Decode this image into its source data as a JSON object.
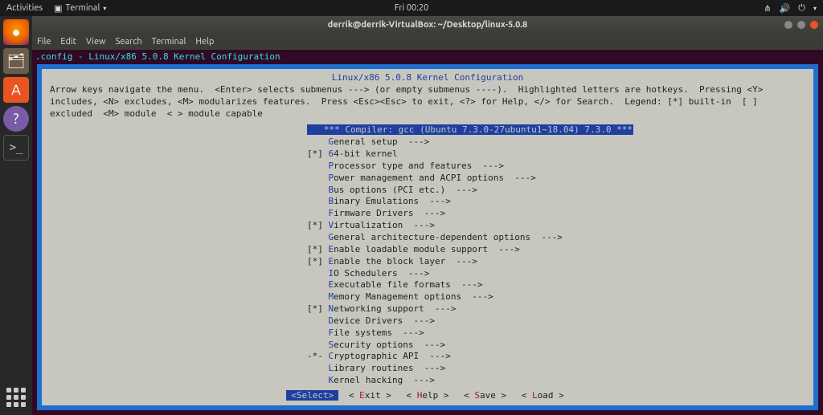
{
  "topbar": {
    "activities": "Activities",
    "app_label": "Terminal",
    "clock": "Fri 00:20"
  },
  "window": {
    "title": "derrik@derrik-VirtualBox: ~/Desktop/linux-5.0.8"
  },
  "menubar": [
    "File",
    "Edit",
    "View",
    "Search",
    "Terminal",
    "Help"
  ],
  "term_title": ".config - Linux/x86 5.0.8 Kernel Configuration",
  "menuconfig": {
    "heading": "Linux/x86 5.0.8 Kernel Configuration",
    "help_text": "Arrow keys navigate the menu.  <Enter> selects submenus ---> (or empty submenus ----).  Highlighted letters are hotkeys.  Pressing <Y> includes, <N> excludes, <M> modularizes features.  Press <Esc><Esc> to exit, <?> for Help, </> for Search.  Legend: [*] built-in  [ ] excluded  <M> module  < > module capable",
    "items": [
      {
        "prefix": "   ",
        "hk": "",
        "label": "*** Compiler: gcc (Ubuntu 7.3.0-27ubuntu1~18.04) 7.3.0 ***",
        "selected": true
      },
      {
        "prefix": "    ",
        "hk": "G",
        "label": "eneral setup  --->"
      },
      {
        "prefix": "[*] ",
        "hk": "6",
        "label": "4-bit kernel"
      },
      {
        "prefix": "    ",
        "hk": "P",
        "label": "rocessor type and features  --->"
      },
      {
        "prefix": "    ",
        "hk": "P",
        "label": "ower management and ACPI options  --->"
      },
      {
        "prefix": "    ",
        "hk": "B",
        "label": "us options (PCI etc.)  --->"
      },
      {
        "prefix": "    ",
        "hk": "B",
        "label": "inary Emulations  --->"
      },
      {
        "prefix": "    ",
        "hk": "F",
        "label": "irmware Drivers  --->"
      },
      {
        "prefix": "[*] ",
        "hk": "V",
        "label": "irtualization  --->"
      },
      {
        "prefix": "    ",
        "hk": "G",
        "label": "eneral architecture-dependent options  --->"
      },
      {
        "prefix": "[*] ",
        "hk": "E",
        "label": "nable loadable module support  --->"
      },
      {
        "prefix": "[*] ",
        "hk": "E",
        "label": "nable the block layer  --->"
      },
      {
        "prefix": "    ",
        "hk": "I",
        "label": "O Schedulers  --->"
      },
      {
        "prefix": "    ",
        "hk": "E",
        "label": "xecutable file formats  --->"
      },
      {
        "prefix": "    ",
        "hk": "M",
        "label": "emory Management options  --->"
      },
      {
        "prefix": "[*] ",
        "hk": "N",
        "label": "etworking support  --->"
      },
      {
        "prefix": "    ",
        "hk": "D",
        "label": "evice Drivers  --->"
      },
      {
        "prefix": "    ",
        "hk": "F",
        "label": "ile systems  --->"
      },
      {
        "prefix": "    ",
        "hk": "S",
        "label": "ecurity options  --->"
      },
      {
        "prefix": "-*- ",
        "hk": "C",
        "label": "ryptographic API  --->"
      },
      {
        "prefix": "    ",
        "hk": "L",
        "label": "ibrary routines  --->"
      },
      {
        "prefix": "    ",
        "hk": "K",
        "label": "ernel hacking  --->"
      }
    ],
    "buttons": [
      {
        "pre": "<",
        "hk": "S",
        "post": "elect>",
        "selected": true
      },
      {
        "pre": "< ",
        "hk": "E",
        "post": "xit >"
      },
      {
        "pre": "< ",
        "hk": "H",
        "post": "elp >"
      },
      {
        "pre": "< ",
        "hk": "S",
        "post": "ave >"
      },
      {
        "pre": "< ",
        "hk": "L",
        "post": "oad >"
      }
    ]
  }
}
